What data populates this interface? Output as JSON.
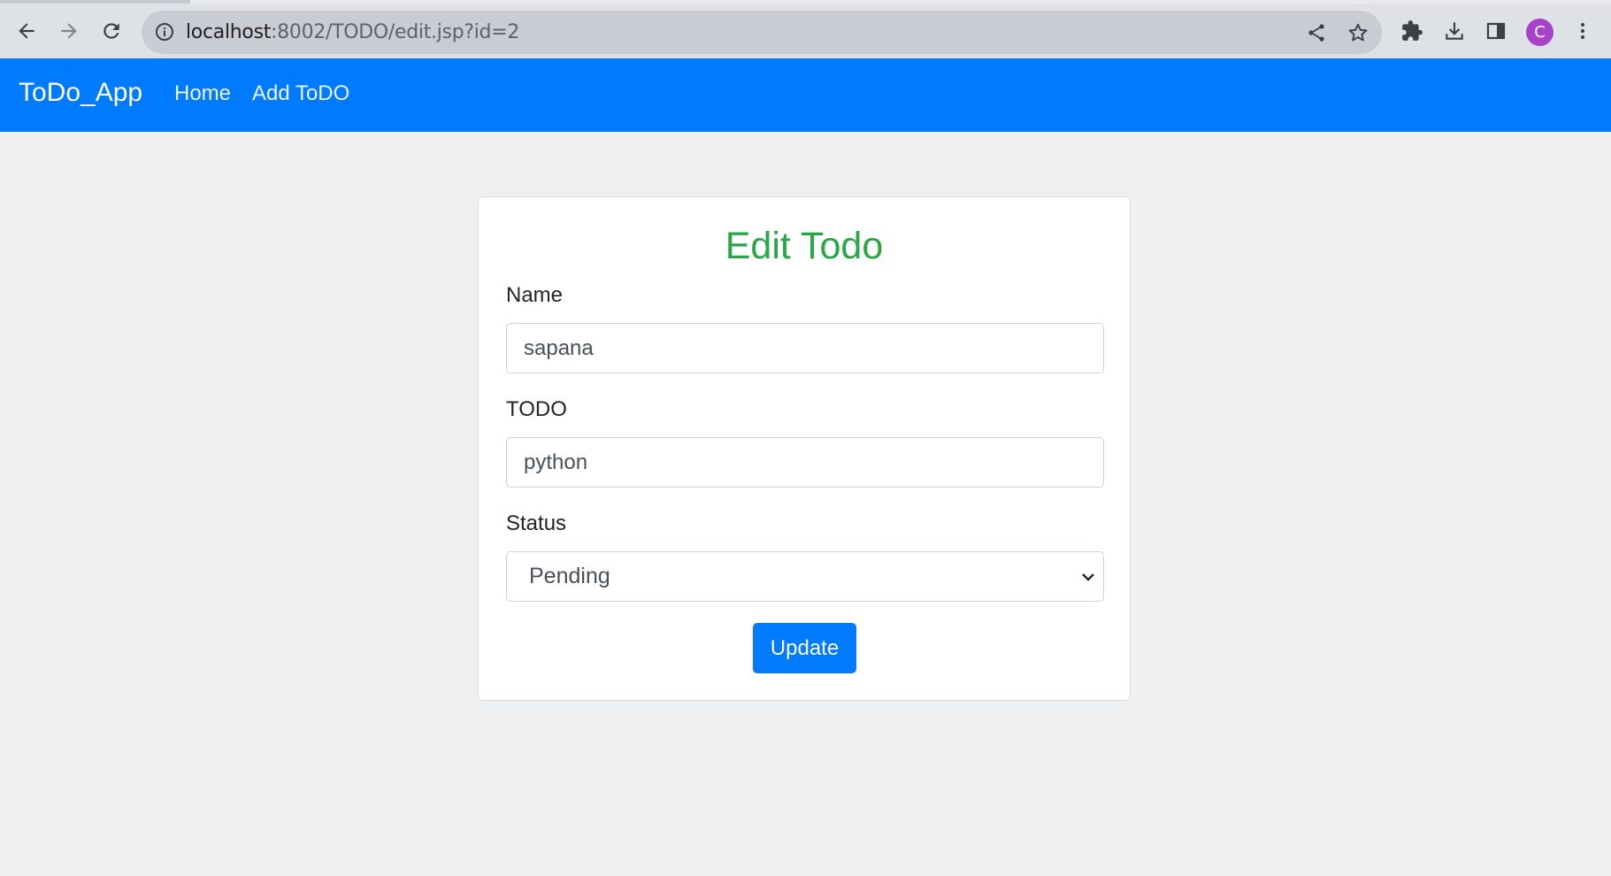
{
  "browser": {
    "url_host": "localhost",
    "url_path": ":8002/TODO/edit.jsp?id=2",
    "profile_initial": "C"
  },
  "navbar": {
    "brand": "ToDo_App",
    "links": [
      "Home",
      "Add ToDO"
    ],
    "background": "#007bff"
  },
  "form": {
    "title": "Edit Todo",
    "title_color": "#28a745",
    "name_label": "Name",
    "name_value": "sapana",
    "todo_label": "TODO",
    "todo_value": "python",
    "status_label": "Status",
    "status_value": "Pending",
    "submit_label": "Update"
  }
}
